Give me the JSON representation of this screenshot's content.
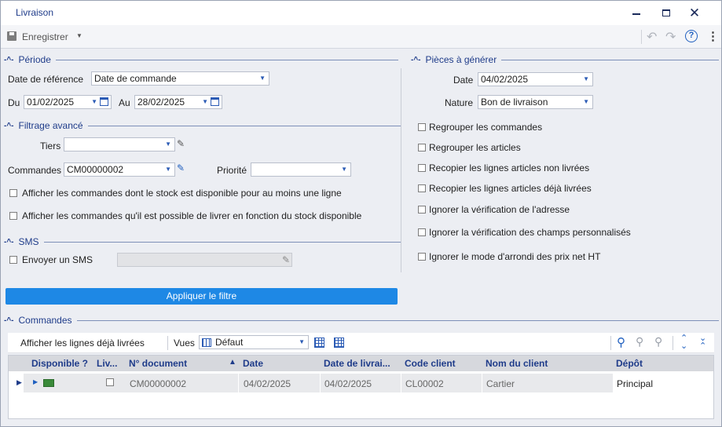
{
  "window": {
    "title": "Livraison"
  },
  "toolbar": {
    "save_label": "Enregistrer"
  },
  "periode": {
    "title": "Période",
    "date_ref_label": "Date de référence",
    "date_ref_value": "Date de commande",
    "du_label": "Du",
    "du_value": "01/02/2025",
    "au_label": "Au",
    "au_value": "28/02/2025"
  },
  "filtrage": {
    "title": "Filtrage avancé",
    "tiers_label": "Tiers",
    "tiers_value": "",
    "commandes_label": "Commandes",
    "commandes_value": "CM00000002",
    "priorite_label": "Priorité",
    "priorite_value": "",
    "check1_label": "Afficher les commandes dont le stock est disponible pour au moins une ligne",
    "check2_label": "Afficher les commandes qu'il est possible de livrer en fonction du stock disponible"
  },
  "sms": {
    "title": "SMS",
    "send_label": "Envoyer un SMS"
  },
  "apply_label": "Appliquer le filtre",
  "pieces": {
    "title": "Pièces à générer",
    "date_label": "Date",
    "date_value": "04/02/2025",
    "nature_label": "Nature",
    "nature_value": "Bon de livraison",
    "options": [
      "Regrouper les commandes",
      "Regrouper les articles",
      "Recopier les lignes articles non livrées",
      "Recopier les lignes articles déjà livrées",
      "Ignorer la vérification de l'adresse",
      "Ignorer la vérification des champs personnalisés",
      "Ignorer le mode d'arrondi des prix net HT"
    ]
  },
  "commandes": {
    "title": "Commandes",
    "show_delivered_label": "Afficher les lignes déjà livrées",
    "vues_label": "Vues",
    "vues_value": "Défaut",
    "columns": [
      "Disponible ?",
      "Liv...",
      "N° document",
      "Date",
      "Date de livrai...",
      "Code client",
      "Nom du client",
      "Dépôt"
    ],
    "rows": [
      {
        "document": "CM00000002",
        "date": "04/02/2025",
        "date_livraison": "04/02/2025",
        "code_client": "CL00002",
        "nom_client": "Cartier",
        "depot": "Principal"
      }
    ]
  }
}
